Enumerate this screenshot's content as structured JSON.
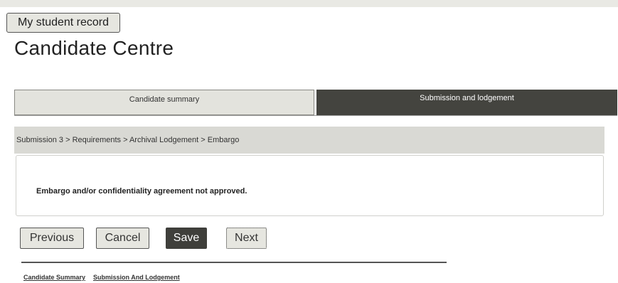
{
  "header": {
    "record_button_label": "My student record",
    "page_title": "Candidate Centre"
  },
  "tabs": [
    {
      "label": "Candidate summary",
      "active": false
    },
    {
      "label": "Submission and lodgement",
      "active": true
    }
  ],
  "breadcrumb": "Submission 3 > Requirements > Archival Lodgement > Embargo",
  "message": "Embargo and/or confidentiality agreement not approved.",
  "actions": {
    "previous_label": "Previous",
    "cancel_label": "Cancel",
    "save_label": "Save",
    "next_label": "Next"
  },
  "footer": {
    "links": [
      "Candidate Summary",
      "Submission And Lodgement"
    ]
  },
  "colors": {
    "active_tab": "#44443f",
    "inactive_tab": "#e3e3dd",
    "breadcrumb_bg": "#d9d9d4",
    "primary_button": "#3f3f3b"
  }
}
